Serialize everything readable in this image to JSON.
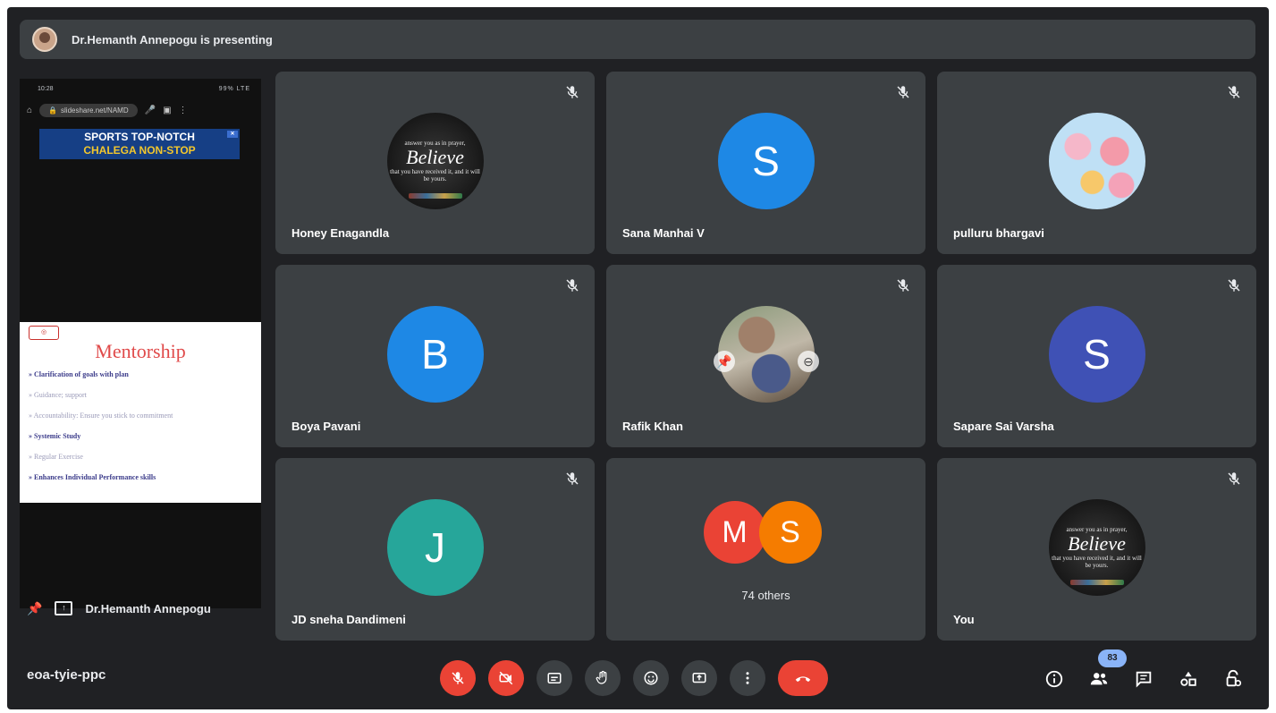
{
  "presenting_bar": {
    "text": "Dr.Hemanth Annepogu is presenting"
  },
  "presentation": {
    "phone_status_time": "10:28",
    "phone_status_right": "99% LTE",
    "browser_url": "slideshare.net/NAMD",
    "ad_line1": "SPORTS TOP-NOTCH",
    "ad_line2": "CHALEGA NON-STOP",
    "slide_title": "Mentorship",
    "slide_bullets": [
      "Clarification of goals with plan",
      "Guidance; support",
      "Accountability: Ensure you stick to commitment",
      "Systemic Study",
      "Regular Exercise",
      "Enhances Individual Performance skills"
    ],
    "presenter_name": "Dr.Hemanth Annepogu"
  },
  "believe_image": {
    "small_top": "answer you as in prayer,",
    "big": "Believe",
    "small_bottom": "that you have received it, and it will be yours."
  },
  "tiles": [
    {
      "name": "Honey Enagandla",
      "type": "image-believe"
    },
    {
      "name": "Sana Manhai V",
      "type": "letter",
      "letter": "S",
      "color": "#1e88e5"
    },
    {
      "name": "pulluru bhargavi",
      "type": "image-flower"
    },
    {
      "name": "Boya Pavani",
      "type": "letter",
      "letter": "B",
      "color": "#1e88e5"
    },
    {
      "name": "Rafik Khan",
      "type": "image-rafik"
    },
    {
      "name": "Sapare Sai Varsha",
      "type": "letter",
      "letter": "S",
      "color": "#3f51b5"
    },
    {
      "name": "JD sneha Dandimeni",
      "type": "letter",
      "letter": "J",
      "color": "#26a69a"
    },
    {
      "name": "74 others",
      "type": "others",
      "letters": [
        "M",
        "S"
      ],
      "colors": [
        "#ea4335",
        "#f57c00"
      ]
    },
    {
      "name": "You",
      "type": "image-believe"
    }
  ],
  "bottom_bar": {
    "meeting_code": "eoa-tyie-ppc",
    "participant_count": "83",
    "colors": {
      "red": "#ea4335",
      "control": "#3c4043",
      "badge": "#8ab4f8"
    }
  }
}
